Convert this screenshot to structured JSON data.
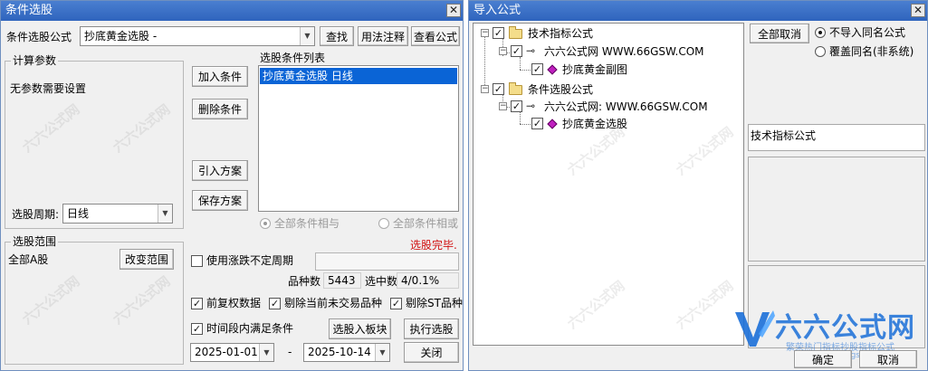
{
  "left_window": {
    "title": "条件选股",
    "formula_label": "条件选股公式",
    "formula_value": "抄底黄金选股  -",
    "btn_find": "查找",
    "btn_usage": "用法注释",
    "btn_view": "查看公式",
    "calc_params_title": "计算参数",
    "no_params": "无参数需要设置",
    "period_label": "选股周期:",
    "period_value": "日线",
    "btn_add": "加入条件",
    "btn_delete": "删除条件",
    "btn_import_plan": "引入方案",
    "btn_save_plan": "保存方案",
    "list_title": "选股条件列表",
    "list_items": [
      "抄底黄金选股  日线"
    ],
    "radio_and": "全部条件相与",
    "radio_or": "全部条件相或",
    "status": "选股完毕.",
    "range_title": "选股范围",
    "range_value": "全部A股",
    "btn_change_range": "改变范围",
    "use_uncertain_period": "使用涨跌不定周期",
    "count_label": "品种数",
    "count_value": "5443",
    "selected_label": "选中数",
    "selected_value": "4/0.1%",
    "pre_adjust": "前复权数据",
    "remove_untraded": "剔除当前未交易品种",
    "remove_st": "剔除ST品种",
    "time_range": "时间段内满足条件",
    "btn_to_block": "选股入板块",
    "btn_execute": "执行选股",
    "date_from": "2025-01-01",
    "date_sep": "-",
    "date_to": "2025-10-14",
    "btn_close": "关闭"
  },
  "right_window": {
    "title": "导入公式",
    "tree": {
      "node1": "技术指标公式",
      "node1_child": "六六公式网 WWW.66GSW.COM",
      "node1_leaf": "抄底黄金副图",
      "node2": "条件选股公式",
      "node2_child": "六六公式网: WWW.66GSW.COM",
      "node2_leaf": "抄底黄金选股"
    },
    "btn_cancel_all": "全部取消",
    "radio_no_import": "不导入同名公式",
    "radio_overwrite": "覆盖同名(非系统)",
    "info_type": "技术指标公式",
    "btn_ok": "确定",
    "btn_cancel": "取消"
  },
  "watermark": {
    "text": "六六公式网",
    "logo_text": "六六公式网",
    "logo_sub": "繁荣热门指标抄股指标公式",
    "logo_url": "www.66gsw.com"
  },
  "colors": {
    "titlebar": "#2f64bd",
    "selection": "#0a64d6",
    "status": "#d11010",
    "logo_blue": "#1b6fd8"
  }
}
